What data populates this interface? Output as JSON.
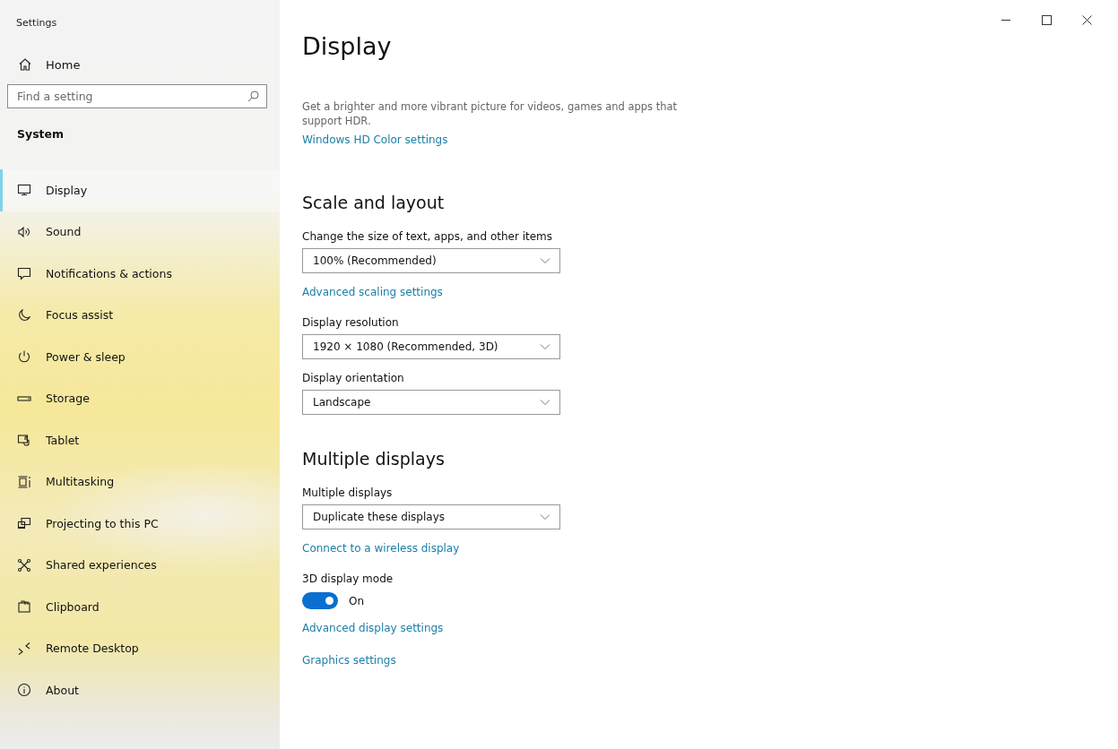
{
  "window": {
    "title": "Settings"
  },
  "sidebar": {
    "home": "Home",
    "search": {
      "placeholder": "Find a setting"
    },
    "section": "System",
    "items": [
      {
        "label": "Display",
        "selected": true
      },
      {
        "label": "Sound",
        "selected": false
      },
      {
        "label": "Notifications & actions",
        "selected": false
      },
      {
        "label": "Focus assist",
        "selected": false
      },
      {
        "label": "Power & sleep",
        "selected": false
      },
      {
        "label": "Storage",
        "selected": false
      },
      {
        "label": "Tablet",
        "selected": false
      },
      {
        "label": "Multitasking",
        "selected": false
      },
      {
        "label": "Projecting to this PC",
        "selected": false
      },
      {
        "label": "Shared experiences",
        "selected": false
      },
      {
        "label": "Clipboard",
        "selected": false
      },
      {
        "label": "Remote Desktop",
        "selected": false
      },
      {
        "label": "About",
        "selected": false
      }
    ]
  },
  "page": {
    "title": "Display",
    "blocks": [
      {
        "kind": "text",
        "text": "Get a brighter and more vibrant picture for videos, games and apps that support HDR."
      },
      {
        "kind": "link",
        "text": "Windows HD Color settings"
      },
      {
        "kind": "heading",
        "text": "Scale and layout"
      },
      {
        "kind": "label",
        "text": "Change the size of text, apps, and other items"
      },
      {
        "kind": "dropdown",
        "value": "100% (Recommended)"
      },
      {
        "kind": "link",
        "text": "Advanced scaling settings"
      },
      {
        "kind": "label",
        "text": "Display resolution"
      },
      {
        "kind": "dropdown",
        "value": "1920 × 1080 (Recommended, 3D)"
      },
      {
        "kind": "label",
        "text": "Display orientation"
      },
      {
        "kind": "dropdown",
        "value": "Landscape"
      },
      {
        "kind": "heading",
        "text": "Multiple displays"
      },
      {
        "kind": "label",
        "text": "Multiple displays"
      },
      {
        "kind": "dropdown",
        "value": "Duplicate these displays"
      },
      {
        "kind": "link",
        "text": "Connect to a wireless display"
      },
      {
        "kind": "label",
        "text": "3D display mode"
      },
      {
        "kind": "toggle",
        "on": true,
        "text": "On"
      },
      {
        "kind": "link",
        "text": "Advanced display settings"
      },
      {
        "kind": "link",
        "text": "Graphics settings"
      }
    ]
  }
}
